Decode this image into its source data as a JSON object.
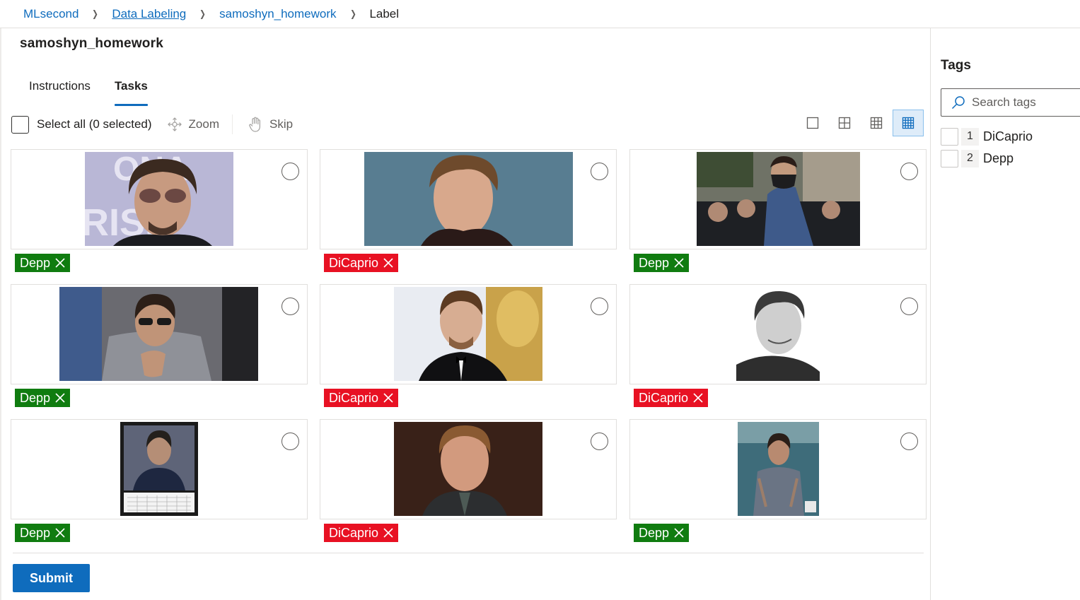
{
  "breadcrumb": {
    "items": [
      "MLsecond",
      "Data Labeling",
      "samoshyn_homework"
    ],
    "current": "Label"
  },
  "page_title": "samoshyn_homework",
  "tabs": [
    {
      "label": "Instructions",
      "active": false
    },
    {
      "label": "Tasks",
      "active": true
    }
  ],
  "toolbar": {
    "select_all_label": "Select all (0 selected)",
    "zoom_label": "Zoom",
    "skip_label": "Skip",
    "view_modes": [
      "1x1",
      "2x2",
      "3x3",
      "4x4"
    ],
    "active_view": "4x4"
  },
  "tasks": [
    {
      "image": "Johnny Depp with tinted glasses at an event",
      "tag": "Depp"
    },
    {
      "image": "Leonardo DiCaprio young portrait on blue background",
      "tag": "DiCaprio"
    },
    {
      "image": "Johnny Depp in blue suit with bandana mask among photographers",
      "tag": "Depp"
    },
    {
      "image": "Johnny Depp in grey suit with sunglasses, hands clasped",
      "tag": "Depp"
    },
    {
      "image": "Leonardo DiCaprio in tuxedo at Oscars",
      "tag": "DiCaprio"
    },
    {
      "image": "Young Leonardo DiCaprio black and white portrait",
      "tag": "DiCaprio"
    },
    {
      "image": "Johnny Depp calendar cover",
      "tag": "Depp"
    },
    {
      "image": "Young Leonardo DiCaprio in suit at event",
      "tag": "DiCaprio"
    },
    {
      "image": "Johnny Depp magazine cover",
      "tag": "Depp"
    }
  ],
  "submit_label": "Submit",
  "tags_panel": {
    "title": "Tags",
    "search_placeholder": "Search tags",
    "items": [
      {
        "key": "1",
        "label": "DiCaprio"
      },
      {
        "key": "2",
        "label": "Depp"
      }
    ]
  },
  "colors": {
    "accent": "#0f6cbd",
    "depp_tag": "#107c10",
    "dicaprio_tag": "#e81123"
  }
}
